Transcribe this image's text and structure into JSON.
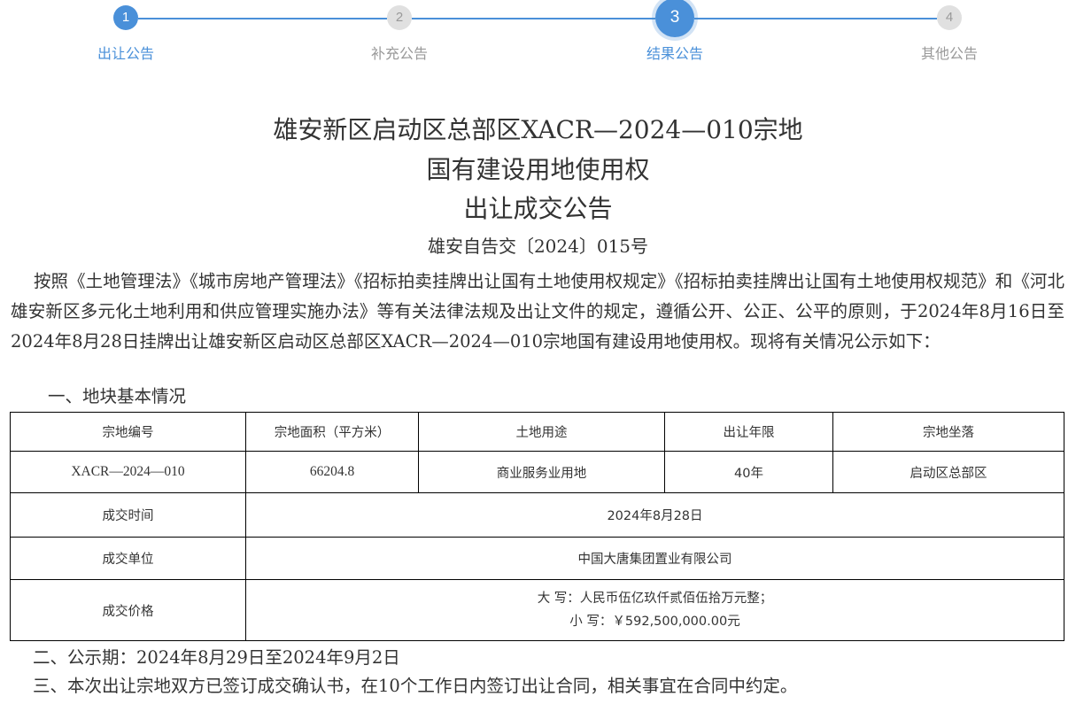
{
  "stepper": {
    "steps": [
      {
        "number": "1",
        "label": "出让公告",
        "state": "completed"
      },
      {
        "number": "2",
        "label": "补充公告",
        "state": "inactive"
      },
      {
        "number": "3",
        "label": "结果公告",
        "state": "active"
      },
      {
        "number": "4",
        "label": "其他公告",
        "state": "inactive"
      }
    ],
    "colors": {
      "active": "#4a90d9",
      "inactive_circle": "#e0e0e0",
      "inactive_text": "#999999",
      "inactive_line": "#dddddd"
    }
  },
  "document": {
    "title_lines": [
      "雄安新区启动区总部区XACR—2024—010宗地",
      "国有建设用地使用权",
      "出让成交公告"
    ],
    "doc_number": "雄安自告交〔2024〕015号",
    "intro_paragraph": "按照《土地管理法》《城市房地产管理法》《招标拍卖挂牌出让国有土地使用权规定》《招标拍卖挂牌出让国有土地使用权规范》和《河北雄安新区多元化土地利用和供应管理实施办法》等有关法律法规及出让文件的规定，遵循公开、公正、公平的原则，于2024年8月16日至2024年8月28日挂牌出让雄安新区启动区总部区XACR—2024—010宗地国有建设用地使用权。现将有关情况公示如下：",
    "section1_heading": "一、地块基本情况",
    "section2": "二、公示期：2024年8月29日至2024年9月2日",
    "section3": "三、本次出让宗地双方已签订成交确认书，在10个工作日内签订出让合同，相关事宜在合同中约定。"
  },
  "table": {
    "headers": [
      "宗地编号",
      "宗地面积（平方米）",
      "土地用途",
      "出让年限",
      "宗地坐落"
    ],
    "row1": [
      "XACR—2024—010",
      "66204.8",
      "商业服务业用地",
      "40年",
      "启动区总部区"
    ],
    "deal_time_label": "成交时间",
    "deal_time_value": "2024年8月28日",
    "deal_unit_label": "成交单位",
    "deal_unit_value": "中国大唐集团置业有限公司",
    "deal_price_label": "成交价格",
    "deal_price_upper": "大 写：人民币伍亿玖仟贰佰伍拾万元整；",
    "deal_price_lower": "小 写：￥592,500,000.00元"
  }
}
